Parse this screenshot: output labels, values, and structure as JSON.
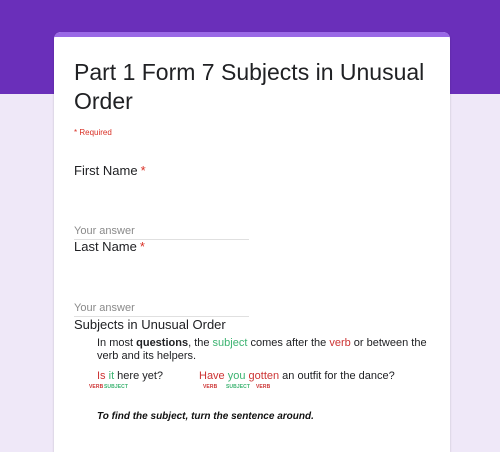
{
  "colors": {
    "header": "#6a2fba",
    "card_accent": "#9a69e6",
    "background": "#efe8f8",
    "required": "#d93025",
    "subject": "#3cb371",
    "verb": "#cc3333"
  },
  "form": {
    "title": "Part 1 Form 7 Subjects in Unusual Order",
    "required_note": "* Required"
  },
  "questions": [
    {
      "label": "First Name",
      "required_mark": "*",
      "placeholder": "Your answer",
      "value": ""
    },
    {
      "label": "Last Name",
      "required_mark": "*",
      "placeholder": "Your answer",
      "value": ""
    }
  ],
  "section": {
    "title": "Subjects in Unusual Order",
    "description": {
      "p1": "In most ",
      "p2": "questions",
      "p3": ", the ",
      "p4": "subject",
      "p5": " comes after the ",
      "p6": "verb",
      "p7": " or between the verb and its helpers."
    },
    "example1": {
      "w1": "Is",
      "w2": " it",
      "w3": " here yet?",
      "tags": {
        "verb": "VERB",
        "subject": "SUBJECT"
      }
    },
    "example2": {
      "w1": "Have",
      "w2": " you",
      "w3": " gotten",
      "w4": " an outfit for the dance?",
      "tags": {
        "verb1": "VERB",
        "subject": "SUBJECT",
        "verb2": "VERB"
      }
    },
    "tip": "To find the subject, turn the sentence around."
  }
}
